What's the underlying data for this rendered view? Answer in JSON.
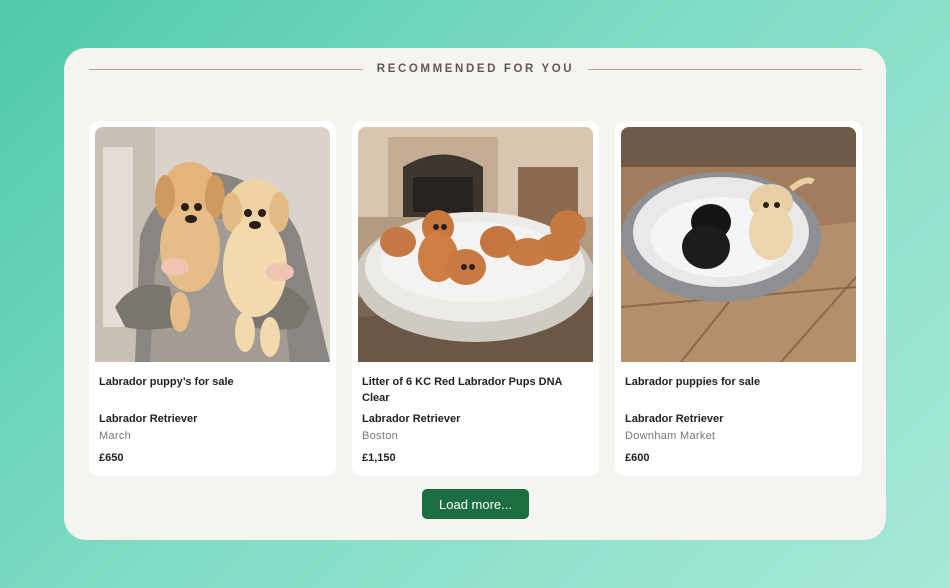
{
  "section": {
    "heading": "RECOMMENDED FOR YOU"
  },
  "listings": [
    {
      "title": "Labrador puppy’s for sale",
      "breed": "Labrador Retriever",
      "location": "March",
      "price": "£650",
      "photo_icon": "two-yellow-labrador-puppies-held-photo"
    },
    {
      "title": "Litter of 6 KC Red Labrador Pups DNA Clear",
      "breed": "Labrador Retriever",
      "location": "Boston",
      "price": "£1,150",
      "photo_icon": "red-labrador-litter-in-dog-bed-photo"
    },
    {
      "title": "Labrador puppies for sale",
      "breed": "Labrador Retriever",
      "location": "Downham Market",
      "price": "£600",
      "photo_icon": "black-and-yellow-labrador-puppies-photo"
    }
  ],
  "load_more": {
    "label": "Load more..."
  },
  "colors": {
    "button": "#1b6e3f",
    "panel": "#f6f4f1",
    "rule": "#b9a58c",
    "background_start": "#4fc9a8",
    "background_end": "#a6e8d8"
  }
}
